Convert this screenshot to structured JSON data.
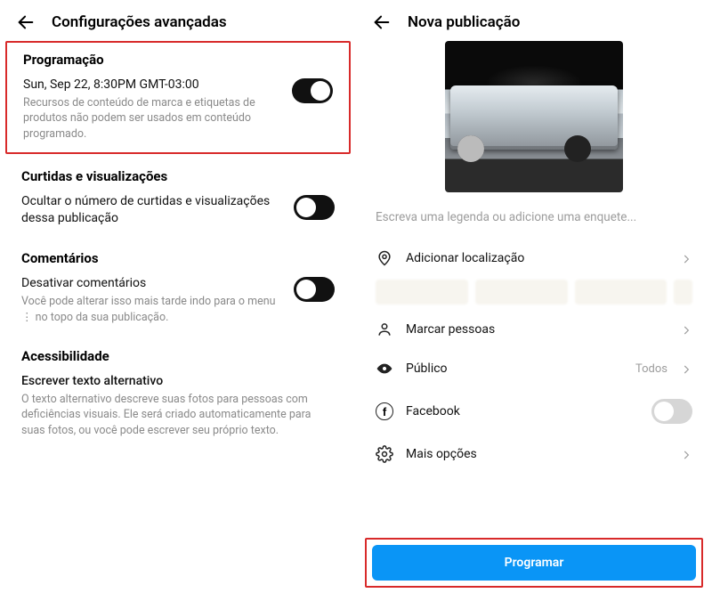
{
  "left": {
    "title": "Configurações avançadas",
    "scheduling": {
      "heading": "Programação",
      "datetime": "Sun, Sep 22, 8:30PM GMT-03:00",
      "desc": "Recursos de conteúdo de marca e etiquetas de produtos não podem ser usados em conteúdo programado.",
      "toggle_on": true
    },
    "likes": {
      "heading": "Curtidas e visualizações",
      "label": "Ocultar o número de curtidas e visualizações dessa publicação",
      "toggle_on": false
    },
    "comments": {
      "heading": "Comentários",
      "label": "Desativar comentários",
      "desc": "Você pode alterar isso mais tarde indo para o menu ⋮ no topo da sua publicação.",
      "toggle_on": false
    },
    "accessibility": {
      "heading": "Acessibilidade",
      "label": "Escrever texto alternativo",
      "desc": "O texto alternativo descreve suas fotos para pessoas com deficiências visuais. Ele será criado automaticamente para suas fotos, ou você pode escrever seu próprio texto."
    }
  },
  "right": {
    "title": "Nova publicação",
    "caption_placeholder": "Escreva uma legenda ou adicione uma enquete...",
    "options": {
      "location": "Adicionar localização",
      "tag": "Marcar pessoas",
      "audience": "Público",
      "audience_value": "Todos",
      "facebook": "Facebook",
      "facebook_on": false,
      "more": "Mais opções"
    },
    "cta": "Programar"
  }
}
